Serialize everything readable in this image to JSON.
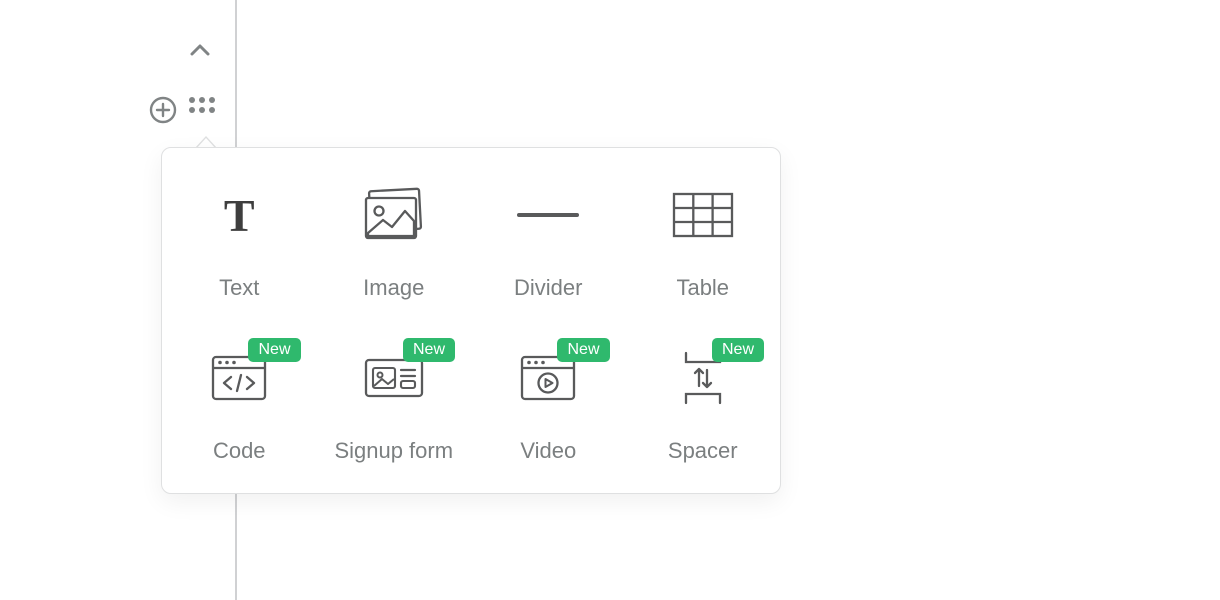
{
  "colors": {
    "badge_bg": "#2fb96d",
    "badge_text": "#ffffff",
    "label": "#7b7f80"
  },
  "badges": {
    "new": "New"
  },
  "items": [
    {
      "key": "text",
      "label": "Text",
      "new": false
    },
    {
      "key": "image",
      "label": "Image",
      "new": false
    },
    {
      "key": "divider",
      "label": "Divider",
      "new": false
    },
    {
      "key": "table",
      "label": "Table",
      "new": false
    },
    {
      "key": "code",
      "label": "Code",
      "new": true
    },
    {
      "key": "signup",
      "label": "Signup form",
      "new": true
    },
    {
      "key": "video",
      "label": "Video",
      "new": true
    },
    {
      "key": "spacer",
      "label": "Spacer",
      "new": true
    }
  ]
}
